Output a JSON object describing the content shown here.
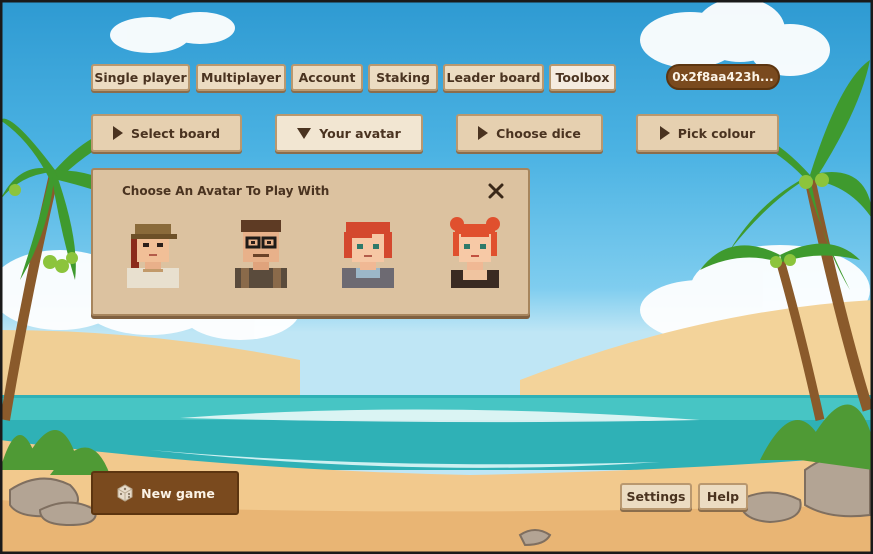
{
  "top_nav": [
    {
      "label": "Single player",
      "active": false
    },
    {
      "label": "Multiplayer",
      "active": false
    },
    {
      "label": "Account",
      "active": false
    },
    {
      "label": "Staking",
      "active": false
    },
    {
      "label": "Leader board",
      "active": false
    },
    {
      "label": "Toolbox",
      "active": true
    }
  ],
  "wallet": {
    "address": "0x2f8aa423h..."
  },
  "toolbox_tabs": [
    {
      "label": "Select board",
      "icon": "play-triangle-icon",
      "expanded": false
    },
    {
      "label": "Your avatar",
      "icon": "down-triangle-icon",
      "expanded": true
    },
    {
      "label": "Choose dice",
      "icon": "play-triangle-icon",
      "expanded": false
    },
    {
      "label": "Pick colour",
      "icon": "play-triangle-icon",
      "expanded": false
    }
  ],
  "avatar_panel": {
    "title": "Choose An Avatar To Play With",
    "close_icon": "close-x-icon",
    "avatars": [
      "explorer-cap-avatar",
      "glasses-man-avatar",
      "redhead-boy-avatar",
      "bun-girl-avatar"
    ]
  },
  "new_game": {
    "label": "New game",
    "icon": "dice-icon"
  },
  "footer": {
    "settings_label": "Settings",
    "help_label": "Help"
  },
  "colors": {
    "button_bg": "#ecdcc2",
    "dark_brown": "#7a4a1e",
    "text": "#4a3320"
  }
}
